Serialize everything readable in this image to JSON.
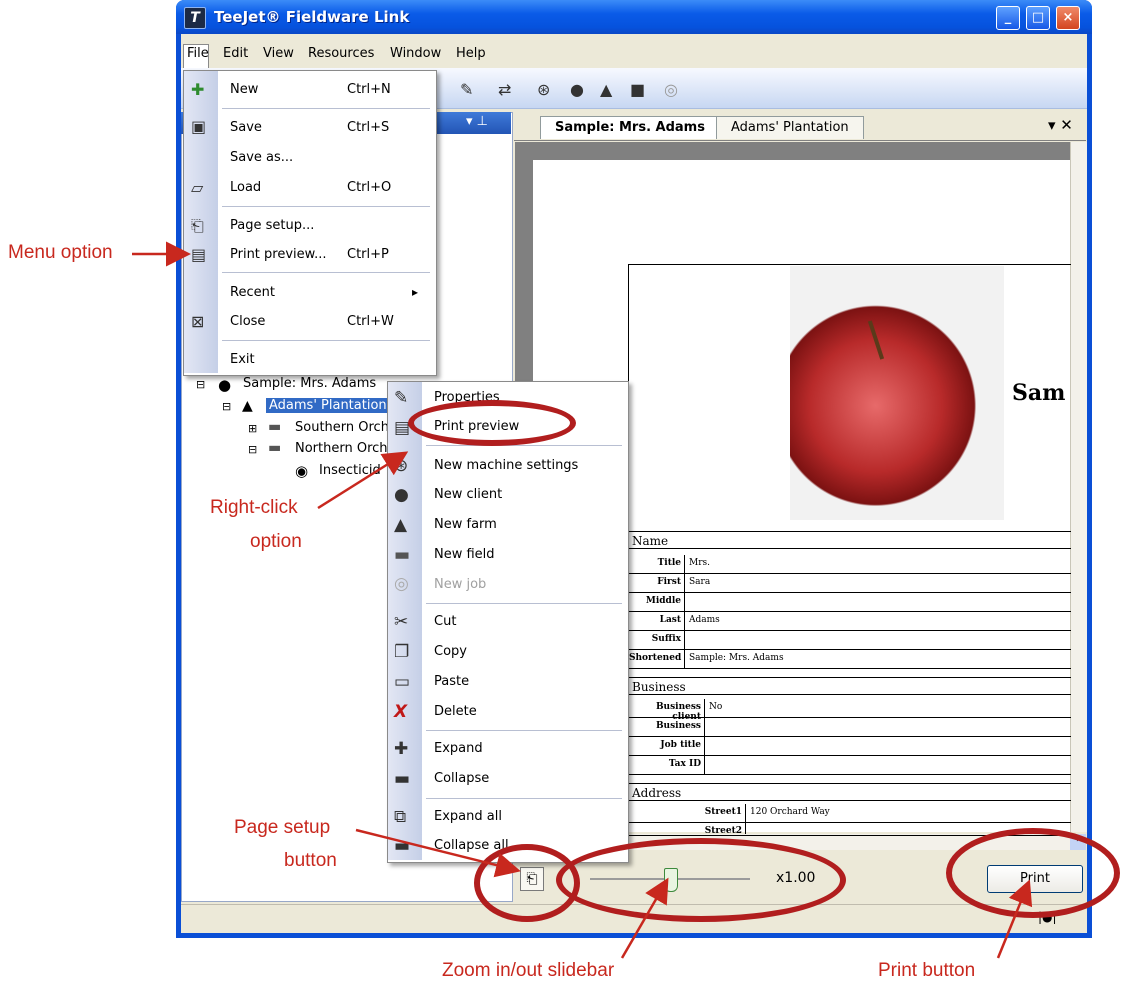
{
  "window": {
    "title": "TeeJet® Fieldware Link",
    "controls": {
      "minimize": "_",
      "maximize": "□",
      "close": "×"
    }
  },
  "menubar": [
    "File",
    "Edit",
    "View",
    "Resources",
    "Window",
    "Help"
  ],
  "file_menu": [
    {
      "label": "New",
      "shortcut": "Ctrl+N",
      "icon": "new-icon"
    },
    {
      "label": "Save",
      "shortcut": "Ctrl+S",
      "icon": "save-icon"
    },
    {
      "label": "Save as...",
      "shortcut": ""
    },
    {
      "label": "Load",
      "shortcut": "Ctrl+O",
      "icon": "folder-open-icon"
    },
    {
      "label": "Page setup...",
      "shortcut": "",
      "icon": "page-setup-icon"
    },
    {
      "label": "Print preview...",
      "shortcut": "Ctrl+P",
      "icon": "print-preview-icon"
    },
    {
      "label": "Recent",
      "shortcut": "▸"
    },
    {
      "label": "Close",
      "shortcut": "Ctrl+W",
      "icon": "close-doc-icon"
    },
    {
      "label": "Exit",
      "shortcut": ""
    }
  ],
  "tree": {
    "client": "Sample: Mrs. Adams",
    "farm": "Adams' Plantation",
    "field1": "Southern Orch",
    "field2": "Northern Orch",
    "job": "Insecticid"
  },
  "context_menu": [
    {
      "label": "Properties",
      "icon": "properties-icon",
      "enabled": true
    },
    {
      "label": "Print preview",
      "icon": "print-preview-icon",
      "enabled": true
    },
    {
      "label": "New machine settings",
      "icon": "steering-wheel-icon",
      "enabled": true
    },
    {
      "label": "New client",
      "icon": "person-icon",
      "enabled": true
    },
    {
      "label": "New farm",
      "icon": "farm-icon",
      "enabled": true
    },
    {
      "label": "New field",
      "icon": "field-icon",
      "enabled": true
    },
    {
      "label": "New job",
      "icon": "job-icon",
      "enabled": false
    },
    {
      "label": "Cut",
      "icon": "scissors-icon",
      "enabled": true
    },
    {
      "label": "Copy",
      "icon": "copy-icon",
      "enabled": true
    },
    {
      "label": "Paste",
      "icon": "paste-icon",
      "enabled": true
    },
    {
      "label": "Delete",
      "icon": "delete-icon",
      "enabled": true
    },
    {
      "label": "Expand",
      "icon": "expand-icon",
      "enabled": true
    },
    {
      "label": "Collapse",
      "icon": "collapse-icon",
      "enabled": true
    },
    {
      "label": "Expand all",
      "icon": "expand-all-icon",
      "enabled": true
    },
    {
      "label": "Collapse all",
      "icon": "collapse-all-icon",
      "enabled": true
    }
  ],
  "tabs": [
    "Sample: Mrs. Adams",
    "Adams' Plantation"
  ],
  "report": {
    "heading": "Sam",
    "sections": {
      "name": "Name",
      "business": "Business",
      "address": "Address"
    },
    "name_fields": [
      {
        "label": "Title",
        "value": "Mrs."
      },
      {
        "label": "First",
        "value": "Sara"
      },
      {
        "label": "Middle",
        "value": ""
      },
      {
        "label": "Last",
        "value": "Adams"
      },
      {
        "label": "Suffix",
        "value": ""
      },
      {
        "label": "Shortened",
        "value": "Sample: Mrs. Adams"
      }
    ],
    "business_fields": [
      {
        "label": "Business client",
        "value": "No"
      },
      {
        "label": "Business",
        "value": ""
      },
      {
        "label": "Job title",
        "value": ""
      },
      {
        "label": "Tax ID",
        "value": ""
      }
    ],
    "address_fields": [
      {
        "label": "Street1",
        "value": "120 Orchard Way"
      },
      {
        "label": "Street2",
        "value": ""
      }
    ]
  },
  "preview_controls": {
    "zoom_label": "x1.00",
    "zoom_value": 1.0,
    "print_label": "Print"
  },
  "annotations": {
    "menu_option": "Menu option",
    "right_click_1": "Right-click",
    "right_click_2": "option",
    "page_setup_1": "Page setup",
    "page_setup_2": "button",
    "zoom": "Zoom in/out slidebar",
    "print": "Print button"
  },
  "colors": {
    "annotation": "#c8281e",
    "titlebar": "#0a5be8",
    "selection": "#316ac5"
  }
}
